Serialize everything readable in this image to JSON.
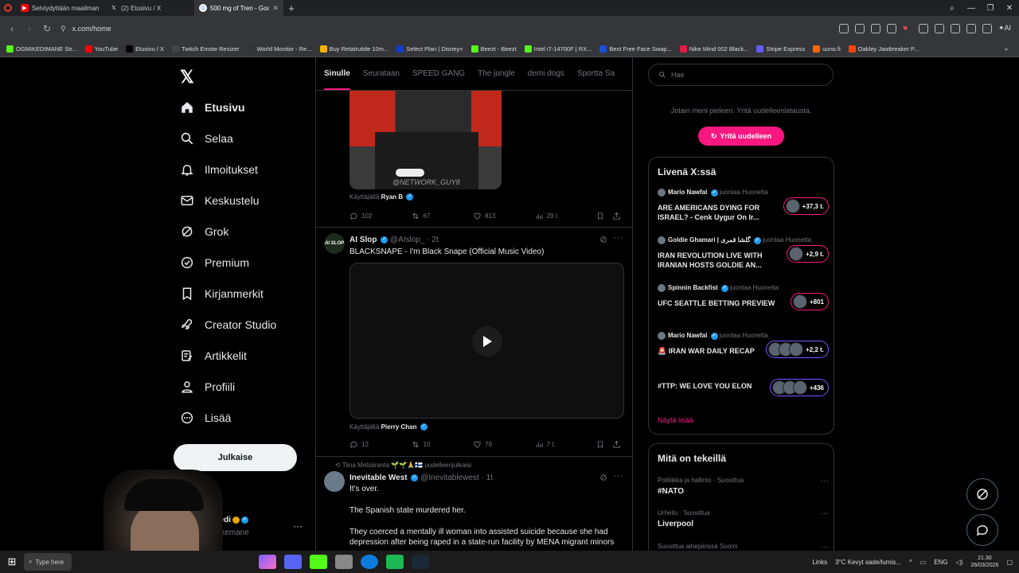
{
  "browser": {
    "tabs": [
      {
        "title": "Selviydyttään maailman v",
        "favicon_color": "#ff0000",
        "active": false
      },
      {
        "title": "(2) Etusivu / X",
        "favicon_color": "#000000",
        "active": false
      },
      {
        "title": "500 mg of Tren - Goog",
        "favicon_color": "#4285f4",
        "active": true
      }
    ],
    "url": "x.com/home",
    "bookmarks": [
      {
        "label": "OGMIKEDIMANE Str...",
        "color": "#53fc18"
      },
      {
        "label": "YouTube",
        "color": "#ff0000"
      },
      {
        "label": "Etusivu / X",
        "color": "#000000"
      },
      {
        "label": "Twitch Emote Resizer",
        "color": "#444444"
      },
      {
        "label": "World Monitor - Re...",
        "color": "#333333"
      },
      {
        "label": "Buy Retatrutide 10m...",
        "color": "#f4b400"
      },
      {
        "label": "Select Plan | Disney+",
        "color": "#113ccf"
      },
      {
        "label": "Beezt - Beezt",
        "color": "#53fc18"
      },
      {
        "label": "Intel i7-14700F | RX...",
        "color": "#53fc18"
      },
      {
        "label": "Best Free Face Swap...",
        "color": "#1d4ed8"
      },
      {
        "label": "Nike Mind 002 Black...",
        "color": "#e11d48"
      },
      {
        "label": "Stripe Express",
        "color": "#635bff"
      },
      {
        "label": "uuno.fi",
        "color": "#ff6600"
      },
      {
        "label": "Oakley Jawbreaker P...",
        "color": "#ff4500"
      }
    ]
  },
  "nav": {
    "items": [
      {
        "label": "Etusivu",
        "icon": "home-icon"
      },
      {
        "label": "Selaa",
        "icon": "search-icon"
      },
      {
        "label": "Ilmoitukset",
        "icon": "bell-icon"
      },
      {
        "label": "Keskustelu",
        "icon": "mail-icon"
      },
      {
        "label": "Grok",
        "icon": "grok-icon"
      },
      {
        "label": "Premium",
        "icon": "verified-icon"
      },
      {
        "label": "Kirjanmerkit",
        "icon": "bookmark-icon"
      },
      {
        "label": "Creator Studio",
        "icon": "rocket-icon"
      },
      {
        "label": "Artikkelit",
        "icon": "article-icon"
      },
      {
        "label": "Profiili",
        "icon": "person-icon"
      },
      {
        "label": "Lisää",
        "icon": "more-circle-icon"
      }
    ],
    "post_label": "Julkaise",
    "profile_name": "kedi",
    "profile_handle": "ikkemane"
  },
  "feed": {
    "tabs": [
      "Sinulle",
      "Seurataan",
      "SPEED GANG",
      "The jungle",
      "demi dogs",
      "Sportta Sa"
    ],
    "tweet1": {
      "watermark": "@NETWORK_GUY8",
      "used_by_prefix": "Käyttäjältä",
      "used_by": "Ryan B",
      "replies": "102",
      "reposts": "67",
      "likes": "813",
      "views": "29 t."
    },
    "tweet2": {
      "name": "AI Slop",
      "handle": "@AIslop_ · 2t",
      "text": "BLACKSNAPE - I'm Black Snape (Official Music Video)",
      "avatar_text": "AI SLOP",
      "used_by_prefix": "Käyttäjältä",
      "used_by": "Pierry Chan",
      "replies": "12",
      "reposts": "10",
      "likes": "79",
      "views": "7 t."
    },
    "tweet3": {
      "repost_line": "Tiina Metsäranta 🌱🌱🙏🇫🇮 uudelleenjulkaisi",
      "name": "Inevitable West",
      "handle": "@Inevitablewest · 1t",
      "line1": "It's over.",
      "line2": "The Spanish state murdered her.",
      "line3": "They coerced a mentally ill woman into assisted suicide because she had",
      "line4": "depression after being raped in a state-run facility by MENA migrant minors"
    }
  },
  "right": {
    "search_placeholder": "Hae",
    "error_text": "Jotain meni pieleen. Yritä uudelleenlatausta.",
    "retry_label": "Yritä uudelleen",
    "live_title": "Livenä X:ssä",
    "live_items": [
      {
        "host": "Mario Nawfal",
        "status": "juontaa Huonetta",
        "title": "ARE AMERICANS DYING FOR ISRAEL? - Cenk Uygur On Ir...",
        "count": "+37,3 t.",
        "color": "#f91880"
      },
      {
        "host": "Goldie Ghamari | گلشا قمری",
        "status": "juontaa Huonetta",
        "title": "IRAN REVOLUTION LIVE WITH IRANIAN HOSTS GOLDIE AN...",
        "count": "+2,9 t.",
        "color": "#f91880"
      },
      {
        "host": "Spinnin Backfist",
        "status": "juontaa Huonetta",
        "title": "UFC SEATTLE BETTING PREVIEW",
        "count": "+801",
        "color": "#f91880"
      },
      {
        "host": "Mario Nawfal",
        "status": "juontaa Huonetta",
        "title": "🚨 IRAN WAR DAILY RECAP",
        "count": "+2,2 t.",
        "color": "#7856ff"
      },
      {
        "host": "",
        "status": "",
        "title": "#TTP: WE LOVE YOU ELON",
        "count": "+436",
        "color": "#7856ff"
      }
    ],
    "show_more": "Näytä lisää",
    "trends_title": "Mitä on tekeillä",
    "trends": [
      {
        "category": "Politiikka ja hallinto · Suosittua",
        "name": "#NATO"
      },
      {
        "category": "Urheilu · Suosittua",
        "name": "Liverpool"
      },
      {
        "category": "Suosittua aihepiirissä Suomi",
        "name": ""
      }
    ]
  },
  "taskbar": {
    "search": "Type here",
    "links": "Links",
    "weather": "3°C  Kevyt sade/lumis...",
    "lang": "ENG",
    "time": "21.30",
    "date": "26/03/2026"
  }
}
